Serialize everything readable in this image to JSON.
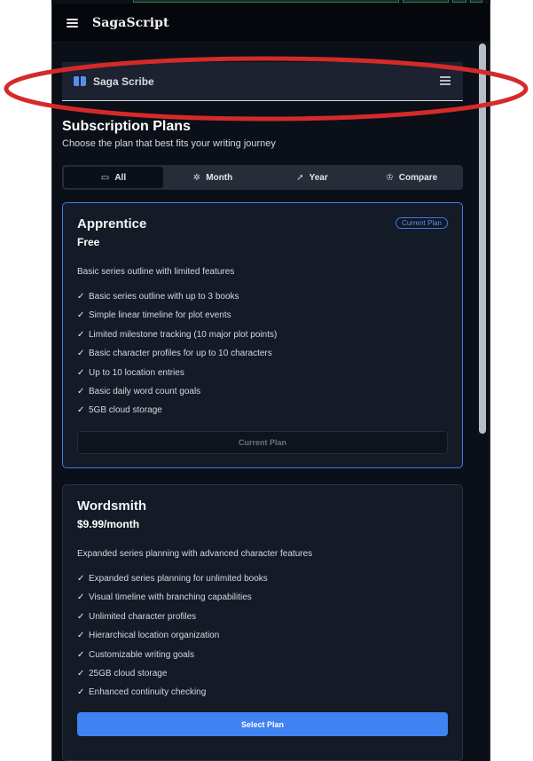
{
  "app": {
    "title": "SagaScript"
  },
  "nav": {
    "brand": "Saga Scribe"
  },
  "page": {
    "title": "Subscription Plans",
    "subtitle": "Choose the plan that best fits your writing journey"
  },
  "tabs": [
    {
      "label": "All",
      "icon": "calendar-icon",
      "active": true
    },
    {
      "label": "Month",
      "icon": "sparkle-icon",
      "active": false
    },
    {
      "label": "Year",
      "icon": "rocket-icon",
      "active": false
    },
    {
      "label": "Compare",
      "icon": "crown-icon",
      "active": false
    }
  ],
  "plans": [
    {
      "name": "Apprentice",
      "price": "Free",
      "badge": "Current Plan",
      "description": "Basic series outline with limited features",
      "features": [
        "Basic series outline with up to 3 books",
        "Simple linear timeline for plot events",
        "Limited milestone tracking (10 major plot points)",
        "Basic character profiles for up to 10 characters",
        "Up to 10 location entries",
        "Basic daily word count goals",
        "5GB cloud storage"
      ],
      "button": "Current Plan"
    },
    {
      "name": "Wordsmith",
      "price": "$9.99/month",
      "description": "Expanded series planning with advanced character features",
      "features": [
        "Expanded series planning for unlimited books",
        "Visual timeline with branching capabilities",
        "Unlimited character profiles",
        "Hierarchical location organization",
        "Customizable writing goals",
        "25GB cloud storage",
        "Enhanced continuity checking"
      ],
      "button": "Select Plan"
    }
  ],
  "colors": {
    "accent": "#3f82f2",
    "annotation": "#d42a2a",
    "background": "#0b0f17"
  }
}
